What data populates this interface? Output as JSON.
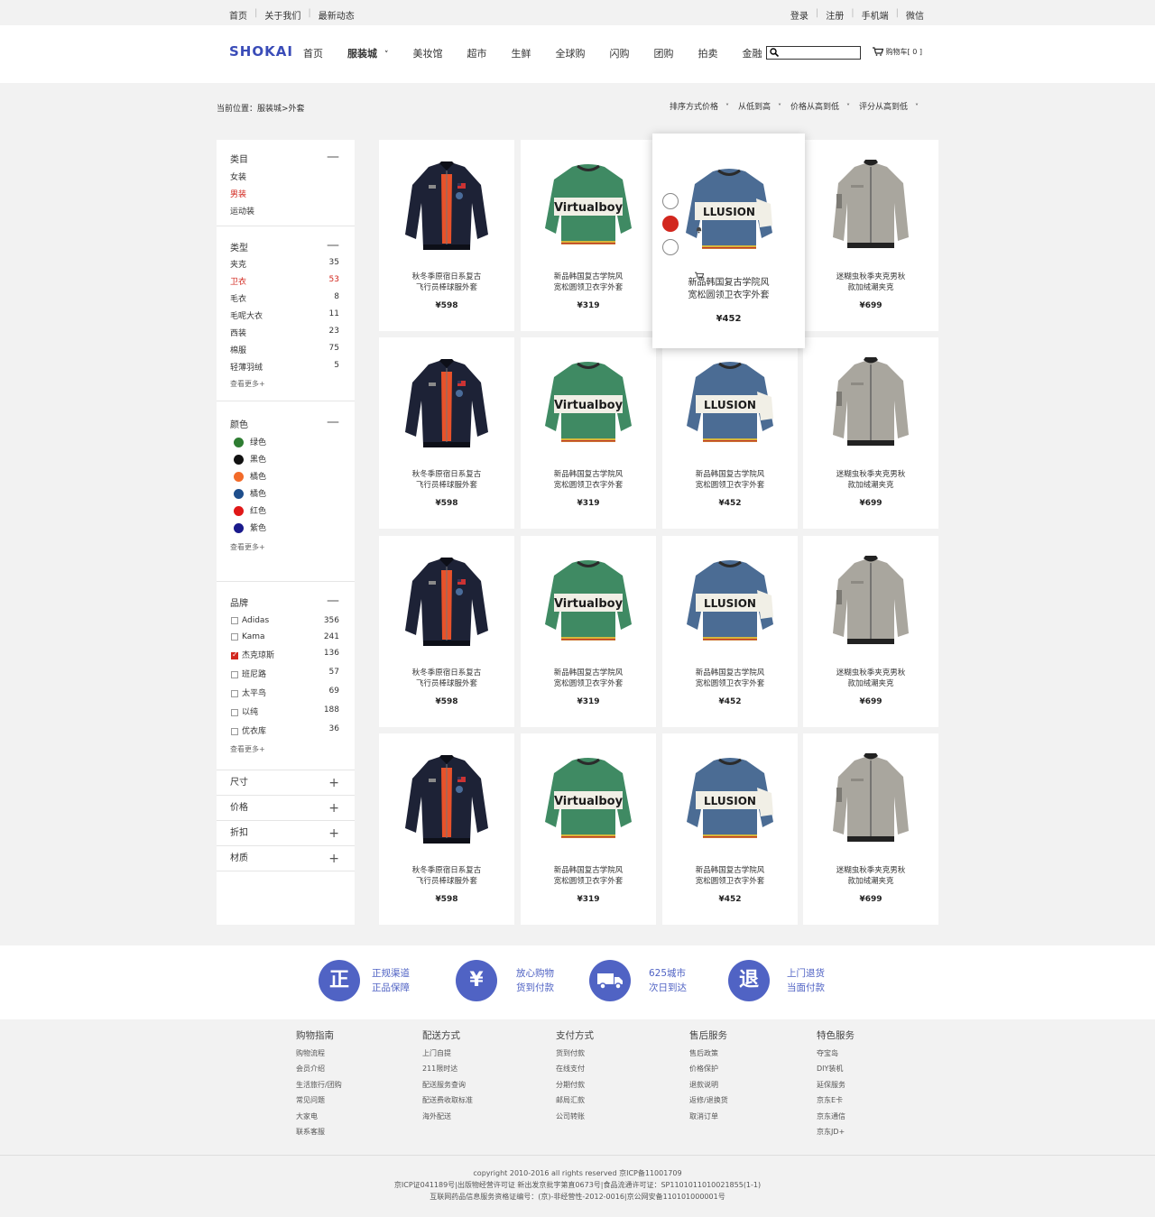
{
  "topbar": {
    "left": [
      "首页",
      "关于我们",
      "最新动态"
    ],
    "right": [
      "登录",
      "注册",
      "手机端",
      "微信"
    ]
  },
  "header": {
    "logo": "SHOKAI",
    "nav": [
      "首页",
      "服装城",
      "美妆馆",
      "超市",
      "生鲜",
      "全球购",
      "闪购",
      "团购",
      "拍卖",
      "金融"
    ],
    "active_nav": "服装城",
    "cart_label": "购物车[ 0 ]"
  },
  "breadcrumb": "当前位置：服装城>外套",
  "sort": [
    "排序方式价格",
    "从低到高",
    "价格从高到低",
    "评分从高到低"
  ],
  "sidebar": {
    "category": {
      "title": "类目",
      "items": [
        "女装",
        "男装",
        "运动装"
      ],
      "active": "男装"
    },
    "type": {
      "title": "类型",
      "items": [
        {
          "label": "夹克",
          "count": "35"
        },
        {
          "label": "卫衣",
          "count": "53"
        },
        {
          "label": "毛衣",
          "count": "8"
        },
        {
          "label": "毛呢大衣",
          "count": "11"
        },
        {
          "label": "西装",
          "count": "23"
        },
        {
          "label": "棉服",
          "count": "75"
        },
        {
          "label": "轻薄羽绒",
          "count": "5"
        }
      ],
      "active": "卫衣",
      "more": "查看更多+"
    },
    "color": {
      "title": "颜色",
      "items": [
        {
          "label": "绿色",
          "hex": "#2e7d32"
        },
        {
          "label": "黑色",
          "hex": "#111111"
        },
        {
          "label": "橘色",
          "hex": "#f26b2a"
        },
        {
          "label": "橘色",
          "hex": "#1e4e8c"
        },
        {
          "label": "红色",
          "hex": "#e01818"
        },
        {
          "label": "紫色",
          "hex": "#1a1a8c"
        }
      ],
      "more": "查看更多+"
    },
    "brand": {
      "title": "品牌",
      "items": [
        {
          "label": "Adidas",
          "count": "356",
          "checked": false
        },
        {
          "label": "Kama",
          "count": "241",
          "checked": false
        },
        {
          "label": "杰克琼斯",
          "count": "136",
          "checked": true
        },
        {
          "label": "班尼路",
          "count": "57",
          "checked": false
        },
        {
          "label": "太平鸟",
          "count": "69",
          "checked": false
        },
        {
          "label": "以纯",
          "count": "188",
          "checked": false
        },
        {
          "label": "优衣库",
          "count": "36",
          "checked": false
        }
      ],
      "more": "查看更多+"
    },
    "folds": [
      "尺寸",
      "价格",
      "折扣",
      "材质"
    ]
  },
  "products": [
    {
      "name1": "秋冬季原宿日系复古",
      "name2": "飞行员棒球服外套",
      "price": "¥598",
      "type": "bomber"
    },
    {
      "name1": "新品韩国复古学院风",
      "name2": "宽松圆领卫衣字外套",
      "price": "¥319",
      "type": "green"
    },
    {
      "name1": "新品韩国复古学院风",
      "name2": "宽松圆领卫衣字外套",
      "price": "¥452",
      "type": "blue"
    },
    {
      "name1": "迷糊虫秋季夹克男秋",
      "name2": "款加绒潮夹克",
      "price": "¥699",
      "type": "grey"
    }
  ],
  "hover_icons": [
    "bell-icon",
    "heart-icon",
    "cart-icon"
  ],
  "sweater_text": {
    "green": "Virtualboy",
    "blue": "LLUSION"
  },
  "guarantees": [
    {
      "icon": "正",
      "line1": "正规渠道",
      "line2": "正品保障"
    },
    {
      "icon": "¥",
      "line1": "放心购物",
      "line2": "货到付款"
    },
    {
      "icon": "truck",
      "line1": "625城市",
      "line2": "次日到达"
    },
    {
      "icon": "退",
      "line1": "上门退货",
      "line2": "当面付款"
    }
  ],
  "footer": [
    {
      "title": "购物指南",
      "links": [
        "购物流程",
        "会员介绍",
        "生活旅行/团购",
        "常见问题",
        "大家电",
        "联系客服"
      ]
    },
    {
      "title": "配送方式",
      "links": [
        "上门自提",
        "211限时达",
        "配送服务查询",
        "配送费收取标准",
        "海外配送"
      ]
    },
    {
      "title": "支付方式",
      "links": [
        "货到付款",
        "在线支付",
        "分期付款",
        "邮局汇款",
        "公司转账"
      ]
    },
    {
      "title": "售后服务",
      "links": [
        "售后政策",
        "价格保护",
        "退款说明",
        "返修/退换货",
        "取消订单"
      ]
    },
    {
      "title": "特色服务",
      "links": [
        "夺宝岛",
        "DIY装机",
        "延保服务",
        "京东E卡",
        "京东通信",
        "京东JD+"
      ]
    }
  ],
  "copyright": [
    "copyright 2010-2016  all rights reserved 京ICP备11001709",
    "京ICP证041189号|出版物经营许可证 新出发京批字第直0673号|食品流通许可证：SP1101011010021855(1-1)",
    "互联网药品信息服务资格证编号：(京)-非经营性-2012-0016|京公网安备110101000001号"
  ]
}
